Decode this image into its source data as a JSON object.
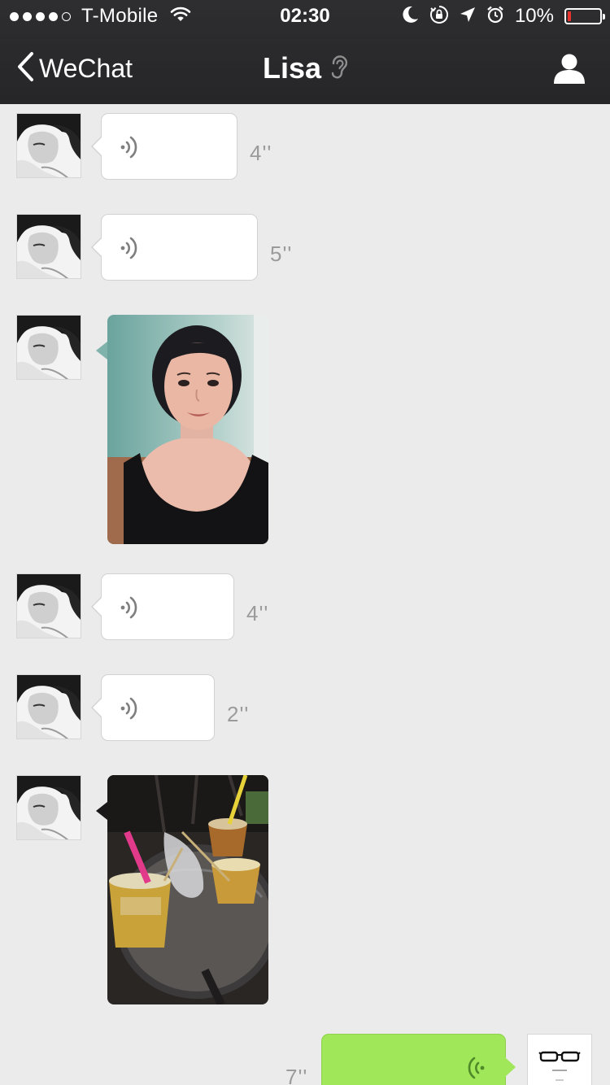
{
  "status_bar": {
    "carrier": "T-Mobile",
    "signal_dots_filled": 4,
    "signal_dots_total": 5,
    "time": "02:30",
    "battery_percent_label": "10%",
    "battery_level": 0.1,
    "icons": [
      "wifi-icon",
      "moon-icon",
      "orientation-lock-icon",
      "location-arrow-icon",
      "alarm-icon",
      "battery-icon"
    ]
  },
  "nav": {
    "back_label": "WeChat",
    "title": "Lisa",
    "title_icon": "ear-icon",
    "right_icon": "profile-icon"
  },
  "messages": [
    {
      "type": "voice",
      "sender": "Lisa",
      "duration": "4''"
    },
    {
      "type": "voice",
      "sender": "Lisa",
      "duration": "5''"
    },
    {
      "type": "photo",
      "sender": "Lisa",
      "subject": "selfie"
    },
    {
      "type": "voice",
      "sender": "Lisa",
      "duration": "4''"
    },
    {
      "type": "voice",
      "sender": "Lisa",
      "duration": "2''"
    },
    {
      "type": "photo",
      "sender": "Lisa",
      "subject": "drinks on table"
    },
    {
      "type": "voice",
      "sender": "me",
      "duration": "7''"
    }
  ],
  "colors": {
    "nav_background": "#2b2b2d",
    "chat_background": "#ebebeb",
    "sent_bubble": "#a0e75a",
    "received_bubble": "#ffffff",
    "battery_low": "#e8332f"
  }
}
